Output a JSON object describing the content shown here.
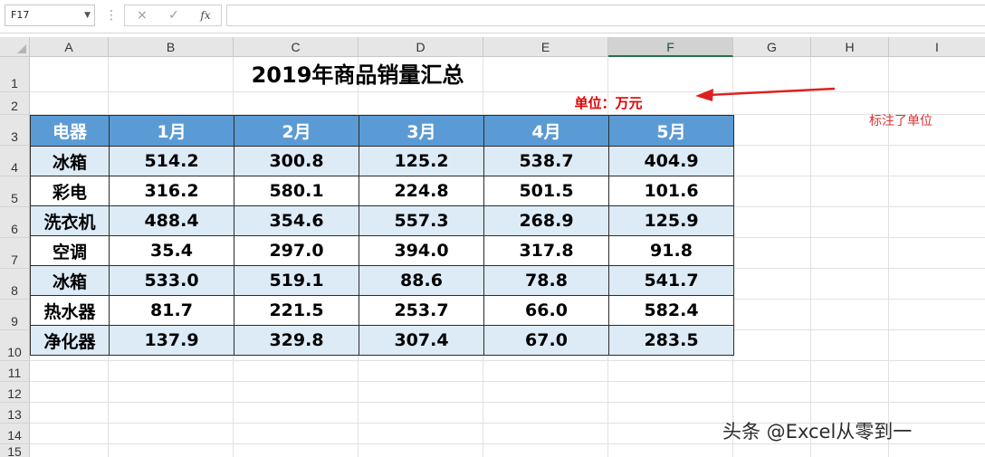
{
  "formula_bar": {
    "name_box": "F17",
    "cancel_icon": "×",
    "enter_icon": "✓",
    "fx_label": "fx",
    "formula": ""
  },
  "columns": [
    "A",
    "B",
    "C",
    "D",
    "E",
    "F",
    "G",
    "H",
    "I"
  ],
  "rows": [
    "1",
    "2",
    "3",
    "4",
    "5",
    "6",
    "7",
    "8",
    "9",
    "10",
    "11",
    "12",
    "13",
    "14",
    "15"
  ],
  "selected_column": "F",
  "sheet": {
    "title": "2019年商品销量汇总",
    "unit": "单位：万元",
    "annotation": "标注了单位",
    "arrow_color": "#e02020",
    "table": {
      "headers": [
        "电器",
        "1月",
        "2月",
        "3月",
        "4月",
        "5月"
      ],
      "rows": [
        [
          "冰箱",
          "514.2",
          "300.8",
          "125.2",
          "538.7",
          "404.9"
        ],
        [
          "彩电",
          "316.2",
          "580.1",
          "224.8",
          "501.5",
          "101.6"
        ],
        [
          "洗衣机",
          "488.4",
          "354.6",
          "557.3",
          "268.9",
          "125.9"
        ],
        [
          "空调",
          "35.4",
          "297.0",
          "394.0",
          "317.8",
          "91.8"
        ],
        [
          "冰箱",
          "533.0",
          "519.1",
          "88.6",
          "78.8",
          "541.7"
        ],
        [
          "热水器",
          "81.7",
          "221.5",
          "253.7",
          "66.0",
          "582.4"
        ],
        [
          "净化器",
          "137.9",
          "329.8",
          "307.4",
          "67.0",
          "283.5"
        ]
      ],
      "header_color": "#5b9bd5",
      "band_color": "#ddebf7"
    }
  },
  "watermark": "头条 @Excel从零到一"
}
